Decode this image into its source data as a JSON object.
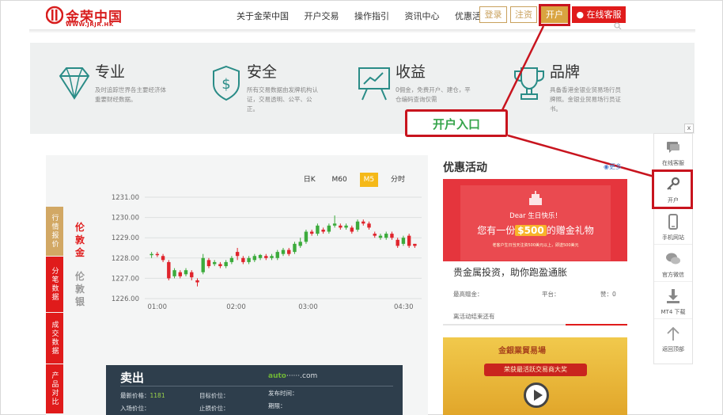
{
  "header": {
    "logo_text": "金荣中国",
    "logo_sub": "WWW.JRJR.HK",
    "nav": [
      "关于金荣中国",
      "开户交易",
      "操作指引",
      "资讯中心",
      "优惠活动"
    ],
    "login_label": "登录",
    "register_label": "注资",
    "open_account_label": "开户",
    "service_label": "在线客服",
    "search_icon": "search-icon"
  },
  "features": [
    {
      "title": "专业",
      "desc": "及时追踪世界各主要经济体重要财经数据。",
      "icon": "diamond-icon"
    },
    {
      "title": "安全",
      "desc": "所有交易数据由发牌机构认证，交易透明、公平、公正。",
      "icon": "shield-dollar-icon"
    },
    {
      "title": "收益",
      "desc": "0佣金，免费开户、建仓，平仓编码查询仅需",
      "icon": "chart-board-icon"
    },
    {
      "title": "品牌",
      "desc": "具备香港金银业贸易场行员牌照。金银业贸易场行员证书。",
      "icon": "trophy-icon"
    }
  ],
  "callout_label": "开户入口",
  "chart": {
    "tabs": [
      "日K",
      "M60",
      "M5",
      "分时"
    ],
    "active_tab": "M5",
    "side_tabs": [
      "行情报价",
      "分笔数据",
      "成交数据",
      "产品对比"
    ],
    "metals": [
      "伦敦金",
      "伦敦银"
    ]
  },
  "chart_data": {
    "type": "candlestick",
    "y_ticks": [
      "1231.00",
      "1230.00",
      "1229.00",
      "1228.00",
      "1227.00",
      "1226.00"
    ],
    "x_ticks": [
      "01:00",
      "02:00",
      "03:00",
      "04:30"
    ],
    "ylim": [
      1226.0,
      1231.0
    ],
    "candles": [
      {
        "o": 1228.15,
        "c": 1228.2,
        "h": 1228.3,
        "l": 1228.0
      },
      {
        "o": 1228.2,
        "c": 1228.15,
        "h": 1228.3,
        "l": 1228.05
      },
      {
        "o": 1228.1,
        "c": 1227.9,
        "h": 1228.2,
        "l": 1227.8
      },
      {
        "o": 1227.8,
        "c": 1227.0,
        "h": 1227.9,
        "l": 1226.9
      },
      {
        "o": 1227.1,
        "c": 1227.4,
        "h": 1227.5,
        "l": 1227.0
      },
      {
        "o": 1227.3,
        "c": 1227.1,
        "h": 1227.4,
        "l": 1227.0
      },
      {
        "o": 1227.2,
        "c": 1227.4,
        "h": 1227.5,
        "l": 1227.1
      },
      {
        "o": 1227.3,
        "c": 1227.05,
        "h": 1227.4,
        "l": 1226.9
      },
      {
        "o": 1226.9,
        "c": 1226.8,
        "h": 1227.0,
        "l": 1226.6
      },
      {
        "o": 1227.3,
        "c": 1228.0,
        "h": 1228.2,
        "l": 1227.2
      },
      {
        "o": 1227.9,
        "c": 1227.6,
        "h": 1228.0,
        "l": 1227.5
      },
      {
        "o": 1227.7,
        "c": 1227.8,
        "h": 1227.9,
        "l": 1227.6
      },
      {
        "o": 1227.7,
        "c": 1227.6,
        "h": 1227.8,
        "l": 1227.5
      },
      {
        "o": 1227.6,
        "c": 1227.8,
        "h": 1227.9,
        "l": 1227.5
      },
      {
        "o": 1227.8,
        "c": 1228.0,
        "h": 1228.1,
        "l": 1227.7
      },
      {
        "o": 1228.3,
        "c": 1228.1,
        "h": 1228.5,
        "l": 1227.9
      },
      {
        "o": 1228.0,
        "c": 1227.8,
        "h": 1228.1,
        "l": 1227.7
      },
      {
        "o": 1227.8,
        "c": 1228.0,
        "h": 1228.1,
        "l": 1227.7
      },
      {
        "o": 1227.9,
        "c": 1228.1,
        "h": 1228.2,
        "l": 1227.8
      },
      {
        "o": 1228.0,
        "c": 1228.15,
        "h": 1228.2,
        "l": 1227.9
      },
      {
        "o": 1228.1,
        "c": 1228.0,
        "h": 1228.2,
        "l": 1227.9
      },
      {
        "o": 1228.0,
        "c": 1228.1,
        "h": 1228.2,
        "l": 1227.9
      },
      {
        "o": 1228.0,
        "c": 1228.3,
        "h": 1228.4,
        "l": 1227.9
      },
      {
        "o": 1228.2,
        "c": 1228.4,
        "h": 1228.5,
        "l": 1228.1
      },
      {
        "o": 1228.4,
        "c": 1228.2,
        "h": 1228.5,
        "l": 1228.1
      },
      {
        "o": 1228.3,
        "c": 1228.7,
        "h": 1228.8,
        "l": 1228.2
      },
      {
        "o": 1228.6,
        "c": 1228.8,
        "h": 1229.0,
        "l": 1228.5
      },
      {
        "o": 1228.8,
        "c": 1229.3,
        "h": 1229.4,
        "l": 1228.7
      },
      {
        "o": 1229.3,
        "c": 1229.2,
        "h": 1229.4,
        "l": 1229.1
      },
      {
        "o": 1229.2,
        "c": 1229.6,
        "h": 1229.7,
        "l": 1229.1
      },
      {
        "o": 1229.4,
        "c": 1229.3,
        "h": 1229.5,
        "l": 1229.2
      },
      {
        "o": 1229.3,
        "c": 1229.6,
        "h": 1229.7,
        "l": 1229.2
      },
      {
        "o": 1229.6,
        "c": 1229.7,
        "h": 1230.1,
        "l": 1229.5
      },
      {
        "o": 1229.6,
        "c": 1229.5,
        "h": 1229.7,
        "l": 1229.4
      },
      {
        "o": 1229.5,
        "c": 1229.6,
        "h": 1229.7,
        "l": 1229.4
      },
      {
        "o": 1229.5,
        "c": 1229.3,
        "h": 1229.6,
        "l": 1229.2
      },
      {
        "o": 1229.4,
        "c": 1229.8,
        "h": 1229.9,
        "l": 1229.3
      },
      {
        "o": 1229.8,
        "c": 1229.7,
        "h": 1229.9,
        "l": 1229.6
      },
      {
        "o": 1229.7,
        "c": 1229.5,
        "h": 1229.8,
        "l": 1229.4
      },
      {
        "o": 1229.2,
        "c": 1229.1,
        "h": 1229.3,
        "l": 1229.0
      },
      {
        "o": 1229.0,
        "c": 1229.1,
        "h": 1229.2,
        "l": 1228.9
      },
      {
        "o": 1229.0,
        "c": 1229.2,
        "h": 1229.3,
        "l": 1228.9
      },
      {
        "o": 1229.2,
        "c": 1229.0,
        "h": 1229.3,
        "l": 1228.9
      },
      {
        "o": 1228.9,
        "c": 1228.6,
        "h": 1229.0,
        "l": 1228.5
      },
      {
        "o": 1228.7,
        "c": 1229.0,
        "h": 1229.1,
        "l": 1228.6
      },
      {
        "o": 1229.1,
        "c": 1228.6,
        "h": 1229.2,
        "l": 1228.5
      },
      {
        "o": 1228.7,
        "c": 1228.6,
        "h": 1228.7,
        "l": 1228.5
      }
    ],
    "grid": true
  },
  "sell_panel": {
    "title": "卖出",
    "logo_prefix": "auto",
    "logo_suffix": ".com",
    "fields": [
      {
        "label": "最新价格：",
        "value": "1181"
      },
      {
        "label": "目标价位：",
        "value": ""
      },
      {
        "label": "发布时间：",
        "value": ""
      },
      {
        "label": "入场价位：",
        "value": ""
      },
      {
        "label": "止损价位：",
        "value": ""
      },
      {
        "label": "期限：",
        "value": ""
      }
    ]
  },
  "promo": {
    "title": "优惠活动",
    "more_label": "更多",
    "banner1": {
      "dear": "Dear 生日快乐！",
      "main_prefix": "您有一份",
      "amount": "$500",
      "main_suffix": "的赠金礼物",
      "small": "老客户生日当天注资500美元以上，即送500美元"
    },
    "item_name": "贵金属投资，助你跑盈通胀",
    "info_left": "最高赠金：",
    "info_mid": "平台：",
    "info_right": "赞：0",
    "remain": "离活动结束还有",
    "banner2_title": "金銀業貿易場",
    "banner2_ribbon": "荣获最活跃交易商大奖"
  },
  "float_bar": {
    "close_label": "x",
    "items": [
      {
        "label": "在线客服",
        "icon": "chat-icon"
      },
      {
        "label": "开户",
        "icon": "key-icon"
      },
      {
        "label": "手机网站",
        "icon": "mobile-icon"
      },
      {
        "label": "官方微信",
        "icon": "wechat-icon"
      },
      {
        "label": "MT4 下载",
        "icon": "download-icon"
      },
      {
        "label": "返回顶部",
        "icon": "arrow-up-icon"
      }
    ]
  }
}
